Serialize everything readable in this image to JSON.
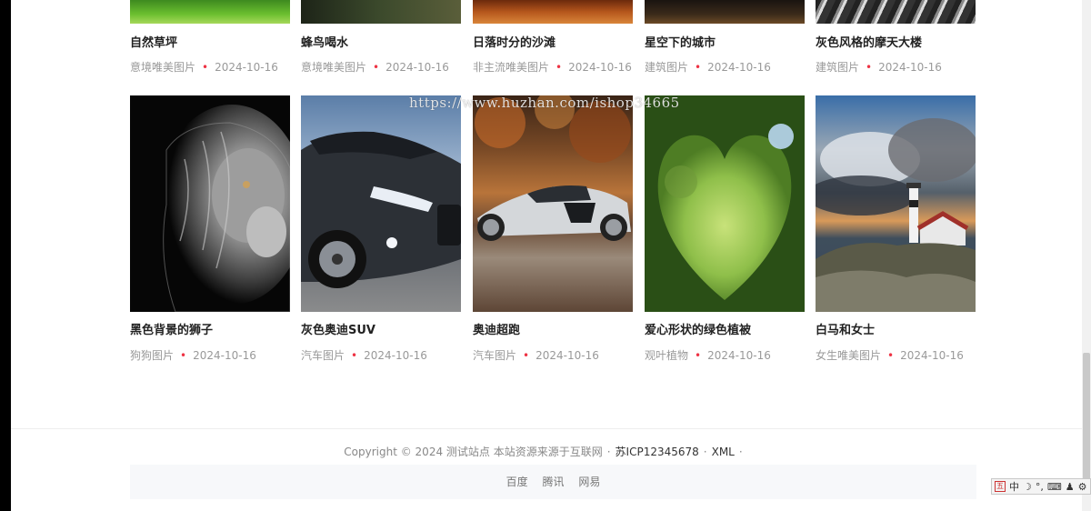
{
  "row1": [
    {
      "title": "自然草坪",
      "category": "意境唯美图片",
      "date": "2024-10-16"
    },
    {
      "title": "蜂鸟喝水",
      "category": "意境唯美图片",
      "date": "2024-10-16"
    },
    {
      "title": "日落时分的沙滩",
      "category": "非主流唯美图片",
      "date": "2024-10-16"
    },
    {
      "title": "星空下的城市",
      "category": "建筑图片",
      "date": "2024-10-16"
    },
    {
      "title": "灰色风格的摩天大楼",
      "category": "建筑图片",
      "date": "2024-10-16"
    }
  ],
  "row2": [
    {
      "title": "黑色背景的狮子",
      "category": "狗狗图片",
      "date": "2024-10-16"
    },
    {
      "title": "灰色奥迪SUV",
      "category": "汽车图片",
      "date": "2024-10-16"
    },
    {
      "title": "奥迪超跑",
      "category": "汽车图片",
      "date": "2024-10-16"
    },
    {
      "title": "爱心形状的绿色植被",
      "category": "观叶植物",
      "date": "2024-10-16"
    },
    {
      "title": "白马和女士",
      "category": "女生唯美图片",
      "date": "2024-10-16"
    }
  ],
  "watermark": "https://www.huzhan.com/ishop34665",
  "footer": {
    "copyright": "Copyright © 2024 测试站点 本站资源来源于互联网",
    "icp": "苏ICP12345678",
    "xml": "XML",
    "sep": "·",
    "links": [
      "百度",
      "腾讯",
      "网易"
    ]
  },
  "ime": {
    "badge": "五",
    "mode": "中"
  },
  "colors": {
    "dot": "#e34",
    "meta": "#999",
    "title": "#222",
    "footer_bg": "#f7f8fa"
  }
}
